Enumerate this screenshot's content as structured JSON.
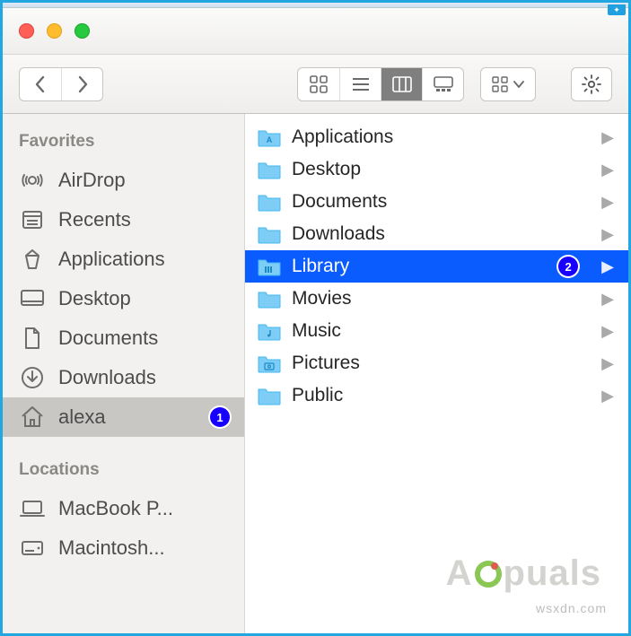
{
  "window": {
    "traffic_lights": [
      "close",
      "minimize",
      "zoom"
    ]
  },
  "toolbar": {
    "nav": {
      "back": "‹",
      "forward": "›"
    },
    "views": [
      "icon",
      "list",
      "column",
      "gallery"
    ],
    "active_view_index": 2,
    "group_menu": "grid",
    "action_menu": "gear"
  },
  "sidebar": {
    "sections": [
      {
        "title": "Favorites",
        "items": [
          {
            "icon": "airdrop",
            "label": "AirDrop",
            "selected": false
          },
          {
            "icon": "recents",
            "label": "Recents",
            "selected": false
          },
          {
            "icon": "applications",
            "label": "Applications",
            "selected": false
          },
          {
            "icon": "desktop",
            "label": "Desktop",
            "selected": false
          },
          {
            "icon": "documents",
            "label": "Documents",
            "selected": false
          },
          {
            "icon": "downloads",
            "label": "Downloads",
            "selected": false
          },
          {
            "icon": "home",
            "label": "alexa",
            "selected": true,
            "badge": "1"
          }
        ]
      },
      {
        "title": "Locations",
        "items": [
          {
            "icon": "laptop",
            "label": "MacBook P...",
            "selected": false
          },
          {
            "icon": "hdd",
            "label": "Macintosh...",
            "selected": false
          }
        ]
      }
    ]
  },
  "content": {
    "items": [
      {
        "icon": "folder-app",
        "label": "Applications",
        "selected": false
      },
      {
        "icon": "folder",
        "label": "Desktop",
        "selected": false
      },
      {
        "icon": "folder",
        "label": "Documents",
        "selected": false
      },
      {
        "icon": "folder",
        "label": "Downloads",
        "selected": false
      },
      {
        "icon": "folder-sys",
        "label": "Library",
        "selected": true,
        "badge": "2"
      },
      {
        "icon": "folder",
        "label": "Movies",
        "selected": false
      },
      {
        "icon": "folder-music",
        "label": "Music",
        "selected": false
      },
      {
        "icon": "folder-pics",
        "label": "Pictures",
        "selected": false
      },
      {
        "icon": "folder",
        "label": "Public",
        "selected": false
      }
    ]
  },
  "watermark": {
    "text_a": "A",
    "text_b": "puals",
    "sub": "wsxdn.com"
  }
}
